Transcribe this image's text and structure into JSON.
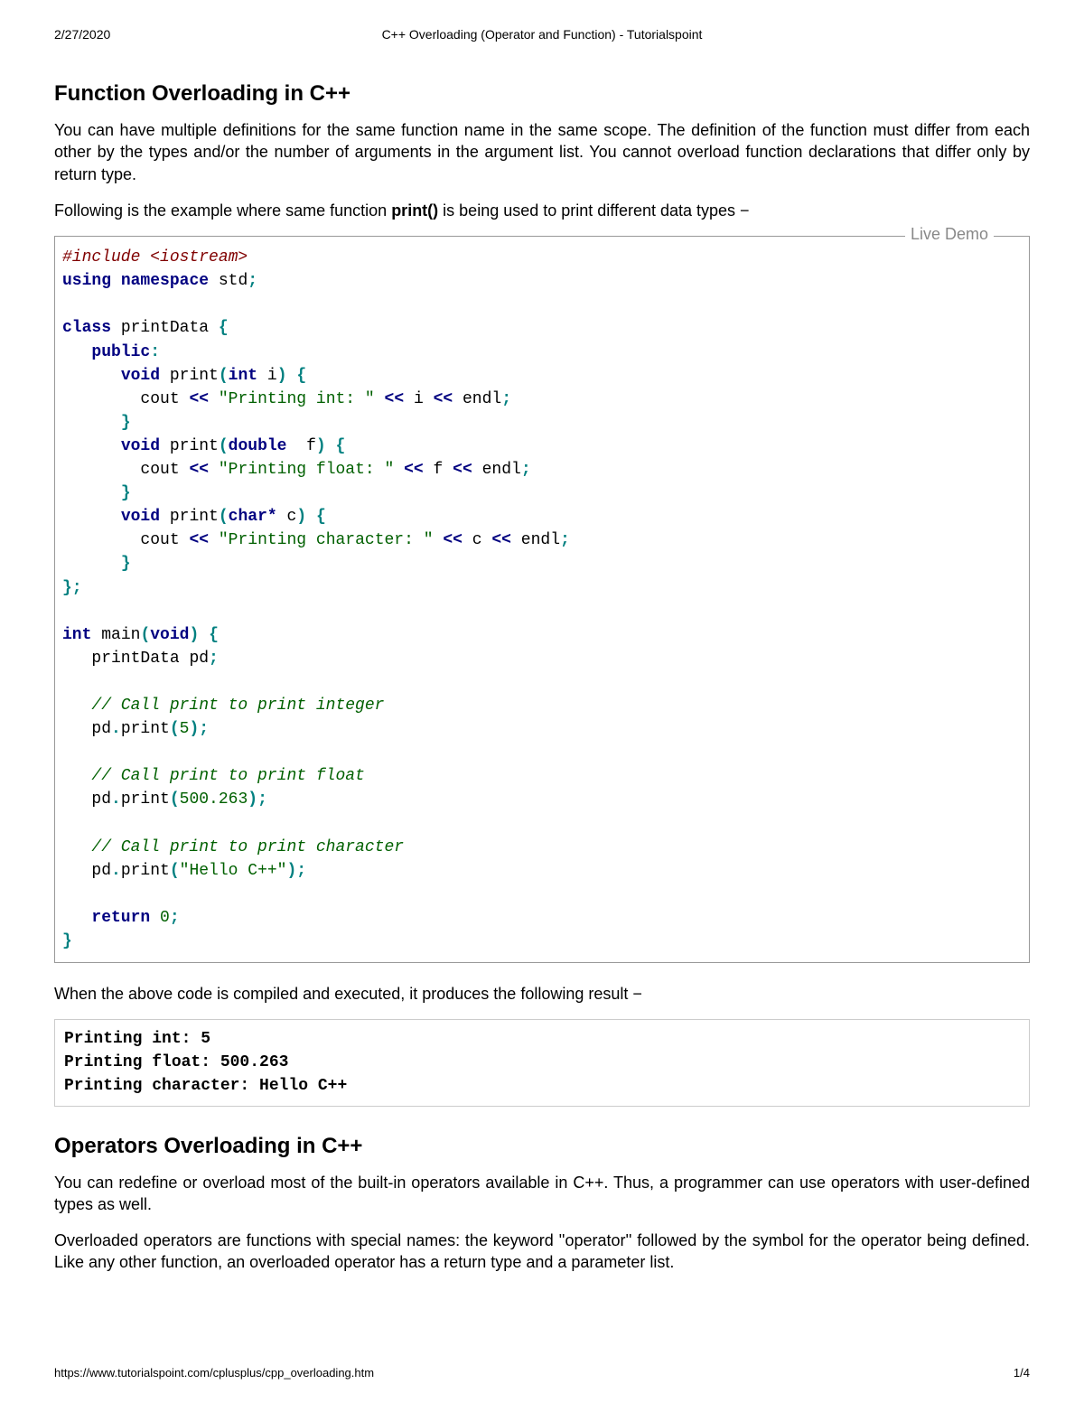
{
  "meta": {
    "date": "2/27/2020",
    "page_header": "C++ Overloading (Operator and Function) - Tutorialspoint",
    "footer_url": "https://www.tutorialspoint.com/cplusplus/cpp_overloading.htm",
    "page_number": "1/4"
  },
  "live_demo_label": "Live Demo",
  "section1": {
    "heading": "Function Overloading in C++",
    "para1": "You can have multiple definitions for the same function name in the same scope. The definition of the function must differ from each other by the types and/or the number of arguments in the argument list. You cannot overload function declarations that differ only by return type.",
    "para2_a": "Following is the example where same function ",
    "para2_bold": "print()",
    "para2_b": " is being used to print different data types −",
    "result_para": "When the above code is compiled and executed, it produces the following result −"
  },
  "code1": {
    "l01": "#include <iostream>",
    "l02a": "using",
    "l02b": "namespace",
    "l02c": "std",
    "l04a": "class",
    "l04b": "printData",
    "l05a": "public",
    "l06a": "void",
    "l06b": "print",
    "l06c": "int",
    "l06d": "i",
    "l07a": "cout",
    "l07b": "\"Printing int: \"",
    "l07c": "i",
    "l07d": "endl",
    "l09a": "void",
    "l09b": "print",
    "l09c": "double",
    "l09d": "f",
    "l10a": "cout",
    "l10b": "\"Printing float: \"",
    "l10c": "f",
    "l10d": "endl",
    "l12a": "void",
    "l12b": "print",
    "l12c": "char",
    "l12d": "c",
    "l13a": "cout",
    "l13b": "\"Printing character: \"",
    "l13c": "c",
    "l13d": "endl",
    "l17a": "int",
    "l17b": "main",
    "l17c": "void",
    "l18a": "printData",
    "l18b": "pd",
    "l20": "// Call print to print integer",
    "l21a": "pd",
    "l21b": "print",
    "l21c": "5",
    "l23": "// Call print to print float",
    "l24a": "pd",
    "l24b": "print",
    "l24c": "500.263",
    "l26": "// Call print to print character",
    "l27a": "pd",
    "l27b": "print",
    "l27c": "\"Hello C++\"",
    "l29a": "return",
    "l29b": "0"
  },
  "output1": {
    "l1": "Printing int: 5",
    "l2": "Printing float: 500.263",
    "l3": "Printing character: Hello C++"
  },
  "section2": {
    "heading": "Operators Overloading in C++",
    "para1": "You can redefine or overload most of the built-in operators available in C++. Thus, a programmer can use operators with user-defined types as well.",
    "para2": "Overloaded operators are functions with special names: the keyword ''operator'' followed by the symbol for the operator being defined. Like any other function, an overloaded operator has a return type and a parameter list."
  }
}
